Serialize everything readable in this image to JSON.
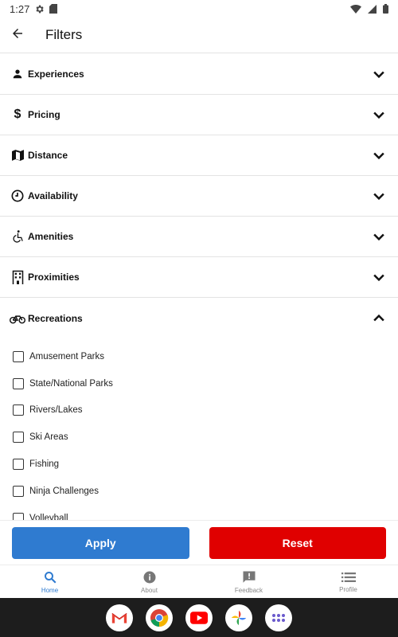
{
  "status_bar": {
    "time": "1:27"
  },
  "app_bar": {
    "title": "Filters"
  },
  "filters": [
    {
      "label": "Experiences",
      "icon": "person-icon",
      "expanded": false
    },
    {
      "label": "Pricing",
      "icon": "dollar-icon",
      "expanded": false
    },
    {
      "label": "Distance",
      "icon": "map-icon",
      "expanded": false
    },
    {
      "label": "Availability",
      "icon": "clock-icon",
      "expanded": false
    },
    {
      "label": "Amenities",
      "icon": "accessible-icon",
      "expanded": false
    },
    {
      "label": "Proximities",
      "icon": "building-icon",
      "expanded": false
    },
    {
      "label": "Recreations",
      "icon": "bike-icon",
      "expanded": true
    }
  ],
  "recreation_options": [
    "Amusement Parks",
    "State/National Parks",
    "Rivers/Lakes",
    "Ski Areas",
    "Fishing",
    "Ninja Challenges",
    "Volleyball"
  ],
  "actions": {
    "apply": "Apply",
    "reset": "Reset"
  },
  "colors": {
    "apply": "#2f7bd0",
    "reset": "#e00000",
    "nav_active": "#2f7bd0"
  },
  "bottom_nav": [
    {
      "label": "Home",
      "icon": "search-icon",
      "active": true
    },
    {
      "label": "About",
      "icon": "info-icon",
      "active": false
    },
    {
      "label": "Feedback",
      "icon": "feedback-icon",
      "active": false
    },
    {
      "label": "Profile",
      "icon": "list-icon",
      "active": false
    }
  ],
  "dock_apps": [
    "gmail-icon",
    "chrome-icon",
    "youtube-icon",
    "photos-icon",
    "app-drawer-icon"
  ]
}
